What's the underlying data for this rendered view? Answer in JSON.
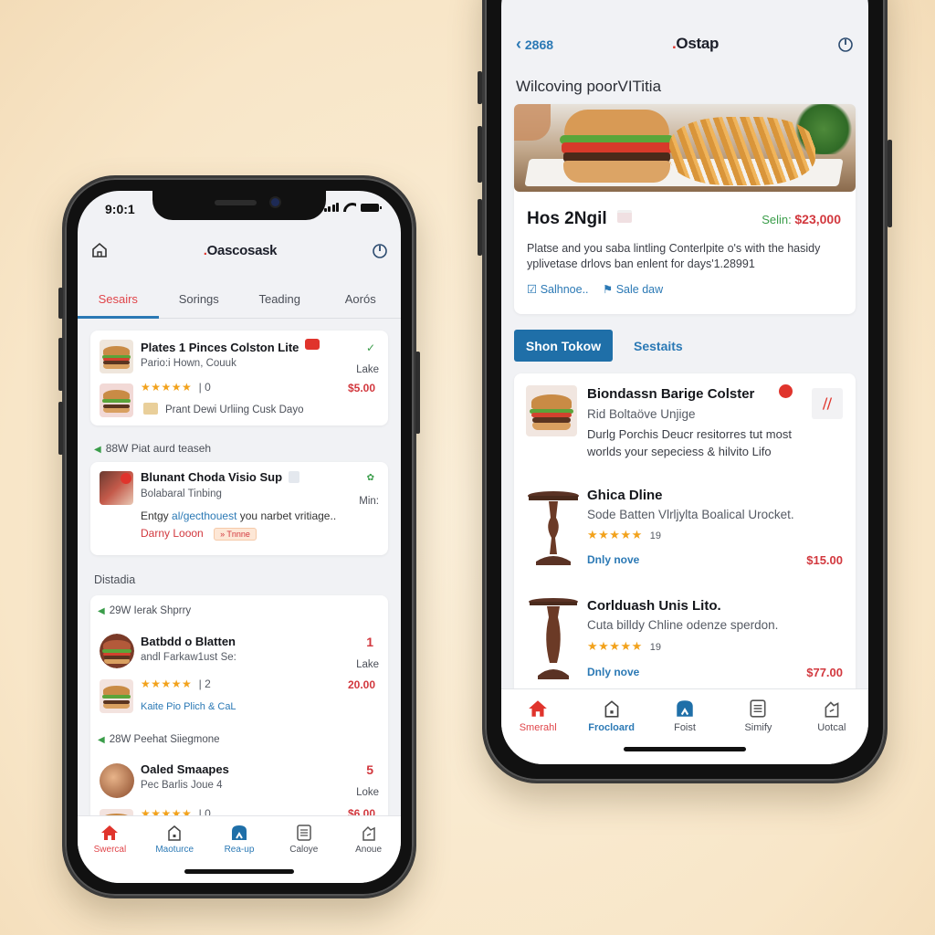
{
  "left_phone": {
    "status_bar": {
      "time": "9:0:1"
    },
    "header": {
      "brand": "Oascosask",
      "home_icon": "home-icon",
      "power_icon": "timer-icon"
    },
    "tabs": [
      {
        "label": "Sesairs",
        "active": true
      },
      {
        "label": "Sorings",
        "active": false
      },
      {
        "label": "Teading",
        "active": false
      },
      {
        "label": "Aorós",
        "active": false
      }
    ],
    "cards": [
      {
        "title": "Plates 1 Pinces Colston Lite",
        "subtitle": "Pario:i Hown, Couuk",
        "rating_count": "0",
        "location": "Lake",
        "price": "$5.00",
        "note": "Prant Dewi Urliing Cusk Dayo"
      },
      {
        "title": "Blunant Choda Visio Sup",
        "subtitle": "Bolabaral Tinbing",
        "side_label": "Min:",
        "desc_prefix": "Entgy ",
        "desc_link": "al/gecthouest",
        "desc_suffix": " you narbet vritiage..",
        "author": "Darny Looon",
        "tag": "Tnnne"
      }
    ],
    "section_before_card2": "88W Piat aurd teaseh",
    "section_heading": "Distadia",
    "list": [
      {
        "section": "29W Ierak Shprry",
        "title": "Batbdd o Blatten",
        "subtitle": "andl Farkaw1ust Se:",
        "qty": "1",
        "location": "Lake",
        "rating_count": "2",
        "price": "20.00",
        "note": "Kaite Pio  Plich & CaL"
      },
      {
        "section": "28W Peehat Siiegmone",
        "title": "Oaled Smaapes",
        "subtitle": "Pec Barlis Joue 4",
        "qty": "5",
        "location": "Loke",
        "rating_count": "0",
        "price": "$6.00"
      }
    ],
    "bottom_nav": [
      {
        "label": "Swercal",
        "icon": "home-filled-icon"
      },
      {
        "label": "Maoturce",
        "icon": "house-outline-icon"
      },
      {
        "label": "Rea-up",
        "icon": "store-icon"
      },
      {
        "label": "Caloye",
        "icon": "list-icon"
      },
      {
        "label": "Anoue",
        "icon": "profile-icon"
      }
    ]
  },
  "right_phone": {
    "header": {
      "back_label": "2868",
      "brand": "Ostap",
      "power_icon": "timer-icon"
    },
    "page_title": "Wilcoving poorVITitia",
    "featured": {
      "title": "Hos 2Ngil",
      "sale_label": "Selin:",
      "price": "$23,000",
      "description": "Platse and you saba lintling Conterlpite o's with the hasidy yplivetase drlovs ban enlent for days'1.28991",
      "action_1": "Salhnoe..",
      "action_2": "Sale daw"
    },
    "buttons": {
      "primary": "Shon Tokow",
      "secondary": "Sestaits"
    },
    "list": [
      {
        "title": "Biondassn Barige Colster",
        "subtitle": "Rid Boltaöve Unjige",
        "description": "Durlg Porchis Deucr resitorres tut most worlds your sepeciess & hilvito Lifo"
      },
      {
        "title": "Ghica Dline",
        "subtitle": "Sode Batten Vlrljylta Boalical Urocket.",
        "rating_count": "19",
        "status": "Dnly nove",
        "price": "$15.00"
      },
      {
        "title": "Corlduash Unis Lito.",
        "subtitle": "Cuta billdy Chline odenze sperdon.",
        "rating_count": "19",
        "status": "Dnly nove",
        "price": "$77.00"
      }
    ],
    "bottom_nav": [
      {
        "label": "Smerahl",
        "icon": "home-filled-icon"
      },
      {
        "label": "Frocloard",
        "icon": "house-outline-icon"
      },
      {
        "label": "Foist",
        "icon": "store-icon"
      },
      {
        "label": "Simify",
        "icon": "list-icon"
      },
      {
        "label": "Uotcal",
        "icon": "profile-icon"
      }
    ]
  },
  "stars": "★★★★★",
  "colors": {
    "accent_blue": "#2b79b5",
    "accent_red": "#e0454a",
    "price_red": "#d2383e",
    "star": "#f2a21c",
    "background": "#f8e6c8"
  }
}
